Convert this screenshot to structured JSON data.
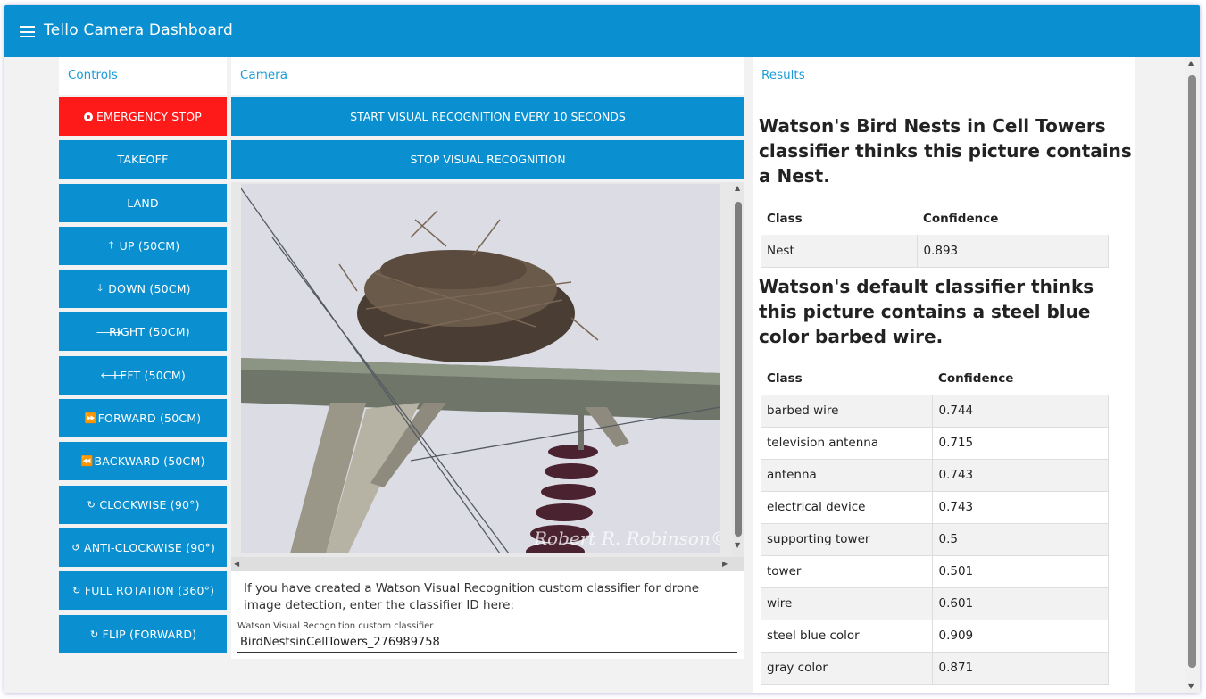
{
  "app": {
    "title": "Tello Camera Dashboard"
  },
  "panels": {
    "controls": "Controls",
    "camera": "Camera",
    "results": "Results"
  },
  "controls": [
    {
      "label": "EMERGENCY STOP",
      "icon": "stop-circle-icon"
    },
    {
      "label": "TAKEOFF",
      "icon": ""
    },
    {
      "label": "LAND",
      "icon": ""
    },
    {
      "label": "UP (50CM)",
      "icon": "arrow-up-icon"
    },
    {
      "label": "DOWN (50CM)",
      "icon": "arrow-down-icon"
    },
    {
      "label": "RIGHT (50CM)",
      "icon": "arrow-right-icon"
    },
    {
      "label": "LEFT (50CM)",
      "icon": "arrow-left-icon"
    },
    {
      "label": "FORWARD (50CM)",
      "icon": "fast-forward-icon"
    },
    {
      "label": "BACKWARD (50CM)",
      "icon": "rewind-icon"
    },
    {
      "label": "CLOCKWISE (90°)",
      "icon": "rotate-clockwise-icon"
    },
    {
      "label": "ANTI-CLOCKWISE (90°)",
      "icon": "rotate-anticlockwise-icon"
    },
    {
      "label": "FULL ROTATION (360°)",
      "icon": "rotate-clockwise-icon"
    },
    {
      "label": "FLIP (FORWARD)",
      "icon": "rotate-clockwise-icon"
    }
  ],
  "camera": {
    "start_label": "START VISUAL RECOGNITION EVERY 10 SECONDS",
    "stop_label": "STOP VISUAL RECOGNITION",
    "watermark": "Robert R. Robinson©",
    "info_text": "If you have created a Watson Visual Recognition custom classifier for drone image detection, enter the classifier ID here:",
    "field_label": "Watson Visual Recognition custom classifier",
    "field_value": "BirdNestsinCellTowers_276989758"
  },
  "results": {
    "custom_heading": "Watson's Bird Nests in Cell Towers classifier thinks this picture contains a Nest.",
    "custom_table": {
      "headers": [
        "Class",
        "Confidence"
      ],
      "rows": [
        [
          "Nest",
          "0.893"
        ]
      ]
    },
    "default_heading": "Watson's default classifier thinks this picture contains a steel blue color barbed wire.",
    "default_table": {
      "headers": [
        "Class",
        "Confidence"
      ],
      "rows": [
        [
          "barbed wire",
          "0.744"
        ],
        [
          "television antenna",
          "0.715"
        ],
        [
          "antenna",
          "0.743"
        ],
        [
          "electrical device",
          "0.743"
        ],
        [
          "supporting tower",
          "0.5"
        ],
        [
          "tower",
          "0.501"
        ],
        [
          "wire",
          "0.601"
        ],
        [
          "steel blue color",
          "0.909"
        ],
        [
          "gray color",
          "0.871"
        ]
      ]
    }
  },
  "colors": {
    "primary": "#0a90d0",
    "danger": "#ff1a1a",
    "accent_text": "#1a9bd7"
  }
}
